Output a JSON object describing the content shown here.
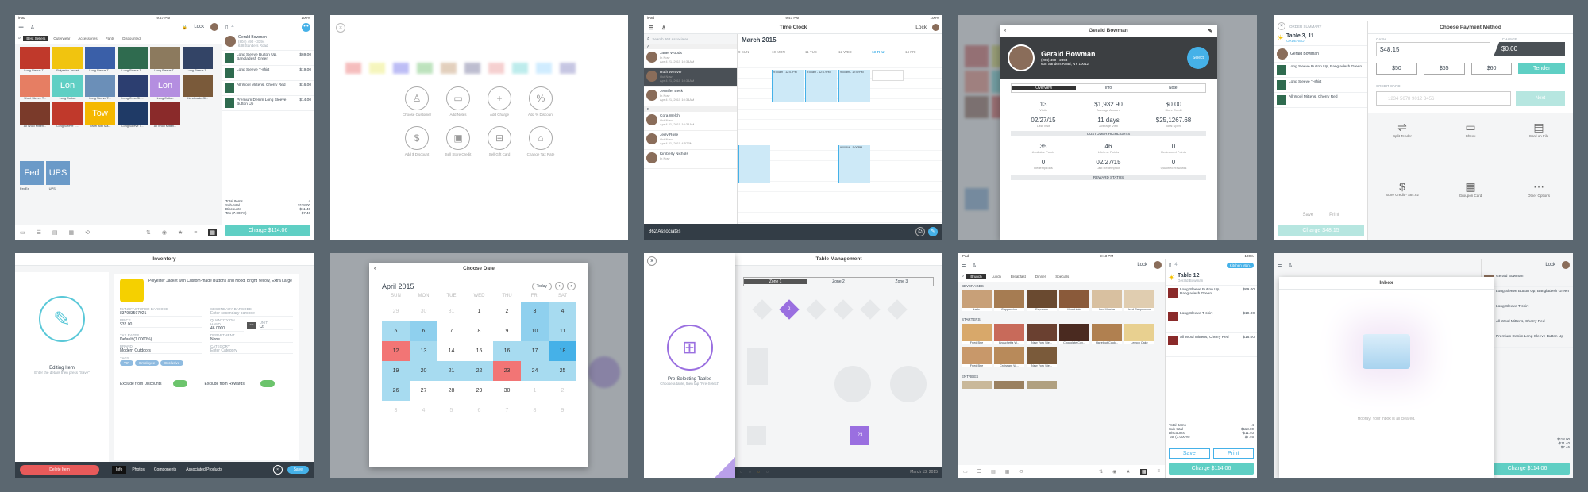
{
  "status": {
    "carrier": "iPad",
    "time": "9:47 PM",
    "time2": "9:13 PM",
    "battery": "100%"
  },
  "register": {
    "lock": "Lock",
    "tabs": [
      "Best Sellers",
      "Outerwear",
      "Accessories",
      "Pants",
      "Discounted"
    ],
    "items": [
      {
        "label": "Long Sleeve T...",
        "color": "#c0392b"
      },
      {
        "label": "Polyester Jacket",
        "color": "#f1c40f"
      },
      {
        "label": "Long Sleeve T...",
        "color": "#3a5fa8"
      },
      {
        "label": "Long Sleeve T...",
        "color": "#2f6b4f"
      },
      {
        "label": "Long Sleeve T...",
        "color": "#8c7a5e"
      },
      {
        "label": "Long Sleeve T...",
        "color": "#334466"
      },
      {
        "label": "Short Sleeve T...",
        "color": "#e67e63"
      },
      {
        "label": "Long Cotton",
        "tile": "Lon",
        "color": "#5fcfc4"
      },
      {
        "label": "Long Sleeve T...",
        "color": "#6b8fb8"
      },
      {
        "label": "Long Crew Sh...",
        "color": "#2c3e70"
      },
      {
        "label": "Long Cotton",
        "tile": "Lon",
        "color": "#b48ee0"
      },
      {
        "label": "Handmade Gl...",
        "color": "#7a5a3a"
      },
      {
        "label": "All Wool Mitten...",
        "color": "#7a3a2a"
      },
      {
        "label": "Long Sleeve T...",
        "color": "#c0392b"
      },
      {
        "label": "Towel with Ma...",
        "tile": "Tow",
        "color": "#f5b800"
      },
      {
        "label": "Long Sleeve T...",
        "color": "#1f3a66"
      },
      {
        "label": "All Wool Mitten...",
        "color": "#8a2a2a"
      }
    ],
    "fedex": "Fed",
    "fedex_label": "FedEx",
    "ups": "UPS",
    "ups_label": "UPS",
    "customer": "Gerald Bowman",
    "customer_sub": "(804) 490 - 3394",
    "customer_addr": "638 Sanders Road",
    "lines": [
      {
        "name": "Long Sleeve Button Up, Bangladesh Green",
        "price": "$69.00"
      },
      {
        "name": "Long Sleeve T-shirt",
        "price": "$19.00"
      },
      {
        "name": "All Wool Mittens, Cherry Red",
        "price": "$16.00"
      },
      {
        "name": "Premium Denim Long Sleeve Button Up",
        "price": "$14.00"
      }
    ],
    "total_items_label": "Total Items",
    "total_items": "4",
    "subtotal_label": "Sub-total",
    "subtotal": "$118.00",
    "discounts_label": "Discounts",
    "discounts": "-$11.40",
    "tax_label": "Tax (7.000%)",
    "tax": "$7.46",
    "charge": "Charge $114.06"
  },
  "actions": {
    "items": [
      "Choose Customer",
      "Add Notes",
      "Add Charge",
      "Add % Discount",
      "Add $ Discount",
      "Sell Store Credit",
      "Sell Gift Card",
      "Change Tax Rate"
    ]
  },
  "timeclock": {
    "title": "Time Clock",
    "lock": "Lock",
    "search": "Search 862 Associates",
    "month": "March 2015",
    "days": [
      "9 SUN",
      "10 MON",
      "11 TUE",
      "12 WED",
      "13 THU",
      "14 FRI"
    ],
    "section_a": "A",
    "section_b": "B",
    "people": [
      {
        "name": "Janet Woods",
        "status": "In Now",
        "time": "Apr 4 21, 2015 10:34AM"
      },
      {
        "name": "Ruth Weaver",
        "status": "Out Now",
        "time": "Apr 4 21, 2015 10:34AM"
      },
      {
        "name": "Jennifer Beck",
        "status": "In Now",
        "time": "Apr 4 21, 2015 10:34AM"
      },
      {
        "name": "Cora Welch",
        "status": "Out Now",
        "time": "Apr 4 21, 2015 10:34AM"
      },
      {
        "name": "Jerry Rose",
        "status": "Out Now",
        "time": "Apr 4 21, 2015 4:57PM"
      },
      {
        "name": "Kimberly Nichols",
        "status": "In Now",
        "time": ""
      }
    ],
    "footer": "862 Associates",
    "blocks": [
      {
        "label": "9:00am - 12:07PM"
      },
      {
        "label": "9:00am - 12:07PM"
      },
      {
        "label": "9:00am - 12:07PM"
      },
      {
        "label": "9:00AM - 5:00PM"
      }
    ]
  },
  "customer": {
    "name": "Gerald Bowman",
    "phone": "(204) 490 - 2394",
    "addr": "638 Sanders Road, NY 10012",
    "button": "Select",
    "tabs": [
      "Overview",
      "Info",
      "Note"
    ],
    "stats": [
      {
        "v": "13",
        "l": "Visits"
      },
      {
        "v": "$1,932.90",
        "l": "Average Amount"
      },
      {
        "v": "$0.00",
        "l": "Store Credit"
      },
      {
        "v": "02/27/15",
        "l": "Last Visit"
      },
      {
        "v": "11 days",
        "l": "Average Visit"
      },
      {
        "v": "$25,1267.68",
        "l": "Total Spent"
      }
    ],
    "highlights": "CUSTOMER HIGHLIGHTS",
    "rewards": [
      {
        "v": "35",
        "l": "Available Points"
      },
      {
        "v": "46",
        "l": "Lifetime Points"
      },
      {
        "v": "0",
        "l": "Redeemed Points"
      },
      {
        "v": "0",
        "l": "Redemptions"
      },
      {
        "v": "02/27/15",
        "l": "Last Redemption"
      },
      {
        "v": "0",
        "l": "Qualified Rewards"
      }
    ],
    "reward_status": "REWARD STATUS"
  },
  "payment": {
    "summary": "ORDER SUMMARY",
    "title": "Choose Payment Method",
    "table": "Table 3, 11",
    "ordered": "ORDERED",
    "cash_label": "CASH",
    "cash": "$48.15",
    "change_label": "CHANGE",
    "change": "$0.00",
    "quick": [
      "$50",
      "$55",
      "$60"
    ],
    "tender": "Tender",
    "credit_label": "CREDIT CARD",
    "card_placeholder": "1234 5678 9012 3456",
    "next": "Next",
    "methods": [
      "Split Tender",
      "Check",
      "Card on File",
      "Store Credit - $84.92",
      "Groupon Card",
      "Other Options"
    ],
    "customer": "Gerald Bowman",
    "lines": [
      "Long Sleeve Button Up, Bangladesh Green",
      "Long Sleeve T-shirt",
      "All Wool Mittens, Cherry Red"
    ],
    "save": "Save",
    "print": "Print",
    "charge": "Charge $48.15"
  },
  "inventory": {
    "title": "Inventory",
    "editing": "Editing Item",
    "editing_hint": "Enter the details then press \"Save\"",
    "desc": "Polyester Jacket with Custom-made Buttons and Hood, Bright Yellow, Extra Large",
    "sku_label": "MANUFACTURER BARCODE",
    "sku": "837983597921",
    "sec_label": "SECONDARY BARCODE",
    "sec_ph": "Enter secondary barcode",
    "price_label": "PRICE",
    "price": "$32.00",
    "qty_label": "QUANTITY ON HAND",
    "qty": "46.0000",
    "unit_label": "UNIT",
    "unit": "Ct",
    "tax_label": "TAX RATES",
    "tax": "Default (7.0000%)",
    "dept_label": "DEPARTMENT",
    "dept": "None",
    "brand_label": "BRAND",
    "brand": "Modern Outdoors",
    "cat_label": "CATEGORY",
    "cat_ph": "Enter Category",
    "tags_label": "TAGS",
    "tags": [
      "VIP",
      "Employee",
      "Exclusive"
    ],
    "excl_disc": "Exclude from Discounts",
    "excl_rew": "Exclude from Rewards",
    "delete": "Delete Item",
    "tabs": [
      "Info",
      "Photos",
      "Components",
      "Associated Products"
    ],
    "save": "Save"
  },
  "calendar": {
    "title": "Choose Date",
    "month": "April 2015",
    "today": "Today",
    "dow": [
      "SUN",
      "MON",
      "TUE",
      "WED",
      "THU",
      "FRI",
      "SAT"
    ],
    "cells": [
      [
        "29",
        "30",
        "31",
        "1",
        "2",
        "3",
        "4"
      ],
      [
        "5",
        "6",
        "7",
        "8",
        "9",
        "10",
        "11"
      ],
      [
        "12",
        "13",
        "14",
        "15",
        "16",
        "17",
        "18"
      ],
      [
        "19",
        "20",
        "21",
        "22",
        "23",
        "24",
        "25"
      ],
      [
        "26",
        "27",
        "28",
        "29",
        "30",
        "1",
        "2"
      ],
      [
        "3",
        "4",
        "5",
        "6",
        "7",
        "8",
        "9"
      ]
    ]
  },
  "tables": {
    "title": "Table Management",
    "zones": [
      "Zone 1",
      "Zone 2",
      "Zone 3"
    ],
    "pre": "Pre-Selecting Tables",
    "pre_hint": "Choose a table, then tap \"Pre-Select\"",
    "d": "2",
    "t23": "23",
    "date": "March 13, 2015"
  },
  "restaurant": {
    "lock": "Lock",
    "tabs": [
      "Brunch",
      "Lunch",
      "Breakfast",
      "Dinner",
      "Specials"
    ],
    "bev": "BEVERAGES",
    "beverages": [
      "Latte",
      "Cappuccino",
      "Espresso",
      "Mocchiato",
      "Iced Mocha",
      "Iced Cappuccino"
    ],
    "starters_label": "STARTERS",
    "starters": [
      "Fried Brie",
      "Bruschetta W...",
      "New York Ste...",
      "Chocolate Cov...",
      "Hazelnut Cook...",
      "Lemon Cake"
    ],
    "starters2": [
      "Fried Brie",
      "Croissant W...",
      "New York Ste..."
    ],
    "entrees": "ENTREES",
    "kitchen": "Kitchen Man.",
    "table": "Table 12",
    "customer": "Gerald Bowman",
    "lines": [
      {
        "name": "Long Sleeve Button Up, Bangladesh Green",
        "price": "$69.00"
      },
      {
        "name": "Long Sleeve T-shirt",
        "price": "$19.00"
      },
      {
        "name": "All Wool Mittens, Cherry Red",
        "price": "$16.00"
      }
    ],
    "total_items_label": "Total Items",
    "total_items": "4",
    "subtotal_label": "Sub-total",
    "subtotal": "$118.00",
    "discounts_label": "Discounts",
    "discounts": "-$11.40",
    "tax_label": "Tax (7.000%)",
    "tax": "$7.46",
    "save": "Save",
    "print": "Print",
    "charge": "Charge $114.06"
  },
  "inbox": {
    "title": "Inbox",
    "empty": "Hooray! Your inbox is all cleared.",
    "charge": "Charge $114.06",
    "lock": "Lock",
    "subtotal": "$118.00",
    "discounts": "-$11.40",
    "tax": "$7.46",
    "lines": [
      "Gerald Bowman",
      "Long Sleeve Button Up, Bangladesh Green",
      "Long Sleeve T-shirt",
      "All Wool Mittens, Cherry Red",
      "Premium Denim Long Sleeve Button Up"
    ]
  }
}
